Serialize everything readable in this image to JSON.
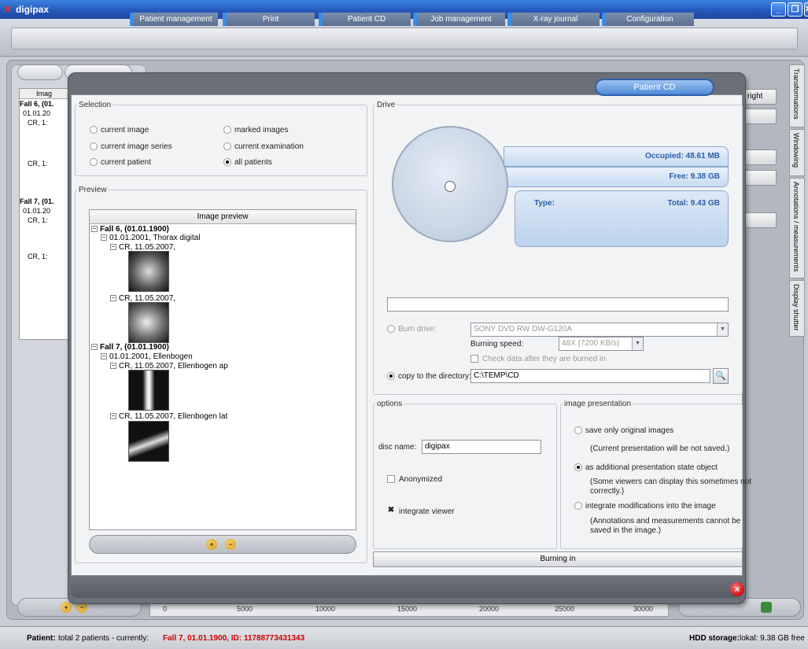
{
  "window": {
    "title": "digipax",
    "controls": [
      "_",
      "❐",
      "✕"
    ]
  },
  "menu": {
    "items": [
      {
        "label": "Patient management"
      },
      {
        "label": "Print"
      },
      {
        "label": "Patient CD"
      },
      {
        "label": "Job management"
      },
      {
        "label": "X-ray journal"
      },
      {
        "label": "Configuration"
      }
    ]
  },
  "background": {
    "tree": [
      "Imag",
      "Fall 6, (01.",
      "01.01.20",
      "CR, 1:",
      "CR, 1:",
      "Fall 7, (01.",
      "01.01.20",
      "CR, 1:",
      "CR, 1:"
    ],
    "side_buttons": [
      "right"
    ],
    "vertical_tabs": [
      "Transformations",
      "Windowing",
      "Annotations / measurements",
      "Display shutter"
    ],
    "scale_ticks": [
      "0",
      "5000",
      "10000",
      "15000",
      "20000",
      "25000",
      "30000"
    ]
  },
  "dialog": {
    "title": "Patient CD",
    "selection": {
      "legend": "Selection",
      "options": [
        {
          "label": "current image",
          "checked": false
        },
        {
          "label": "marked images",
          "checked": false
        },
        {
          "label": "current image series",
          "checked": false
        },
        {
          "label": "current examination",
          "checked": false
        },
        {
          "label": "current patient",
          "checked": false
        },
        {
          "label": "all patients",
          "checked": true
        }
      ]
    },
    "preview": {
      "legend": "Preview",
      "header": "Image preview",
      "tree": {
        "p1": "Fall 6,  (01.01.1900)",
        "p1_exam": "01.01.2001, Thorax digital",
        "p1_s1": "CR, 11.05.2007,",
        "p1_s2": "CR, 11.05.2007,",
        "p2": "Fall 7,  (01.01.1900)",
        "p2_exam": "01.01.2001, Ellenbogen",
        "p2_s1": "CR, 11.05.2007, Ellenbogen ap",
        "p2_s2": "CR, 11.05.2007, Ellenbogen lat"
      }
    },
    "drive": {
      "legend": "Drive",
      "occupied": "Occupied: 48.61 MB",
      "free": "Free: 9.38 GB",
      "type_label": "Type:",
      "total": "Total: 9.43 GB",
      "burn_drive_label": "Burn drive:",
      "burn_drive_value": "SONY     DVD RW DW-G120A",
      "burning_speed_label": "Burning speed:",
      "burning_speed_value": "48X (7200 KB/s)",
      "check_data_label": "Check data after they are burned in",
      "copy_dir_label": "copy to the directory:",
      "copy_dir_value": "C:\\TEMP\\CD"
    },
    "options": {
      "legend": "options",
      "disc_name_label": "disc name:",
      "disc_name_value": "digipax",
      "anonymized_label": "Anonymized",
      "integrate_viewer_label": "integrate viewer",
      "integrate_viewer_checked": true
    },
    "image_presentation": {
      "legend": "image presentation",
      "opt1": "save only original images",
      "opt1_note": "(Current presentation will be not saved.)",
      "opt2": "as additional presentation state object",
      "opt2_note1": "(Some viewers can display this sometimes not",
      "opt2_note2": "correctly.)",
      "opt3": "integrate modifications into the image",
      "opt3_note1": "(Annotations and measurements cannot be",
      "opt3_note2": "saved in the image.)"
    },
    "burn_button": "Burning in"
  },
  "status": {
    "patient_label": "Patient:",
    "patient_text": "total 2 patients - currently:",
    "current": "Fall 7, 01.01.1900, ID: 11788773431343",
    "hdd_label": "HDD storage:",
    "hdd_value": "lokal: 9.38 GB free"
  },
  "colors": {
    "accent": "#3a8ee8",
    "status_red": "#d00000",
    "drive_text": "#2c5ea8"
  }
}
